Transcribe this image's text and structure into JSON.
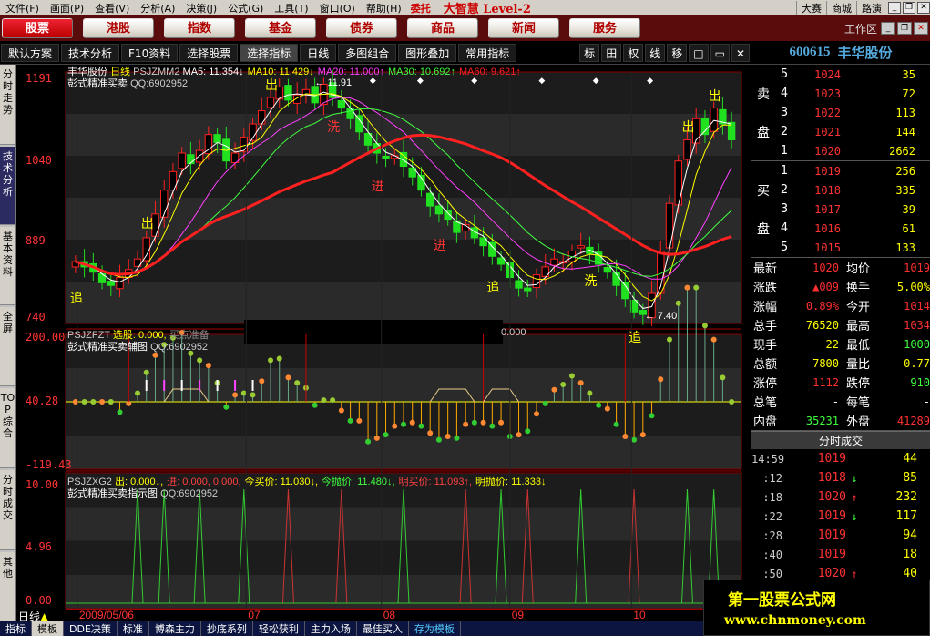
{
  "menu": {
    "items": [
      "文件(F)",
      "画面(P)",
      "查看(V)",
      "分析(A)",
      "决策(J)",
      "公式(G)",
      "工具(T)",
      "窗口(O)",
      "帮助(H)"
    ],
    "weituo": "委托",
    "brand": "大智慧 Level-2",
    "right_items": [
      "大赛",
      "商城",
      "路演"
    ]
  },
  "nav": {
    "buttons": [
      "股票",
      "港股",
      "指数",
      "基金",
      "债券",
      "商品",
      "新闻",
      "服务"
    ],
    "active_index": 0,
    "workspace": "工作区"
  },
  "toolbar": {
    "items": [
      "默认方案",
      "技术分析",
      "F10资料",
      "选择股票",
      "选择指标",
      "日线",
      "多图组合",
      "图形叠加",
      "常用指标"
    ],
    "small": [
      "标",
      "田",
      "权",
      "线",
      "移"
    ]
  },
  "left_tabs": [
    "分时走势",
    "技术分析",
    "基本资料",
    "全屏",
    "TOP综合",
    "分时成交",
    "其他"
  ],
  "left_tab_active": 1,
  "chart": {
    "main_name": "丰华股份",
    "period": "日线",
    "ind1": "PSJZMM2",
    "ma_texts": [
      {
        "t": "MA5: 11.354↓",
        "c": "#ffffff"
      },
      {
        "t": "MA10: 11.429↓",
        "c": "#ffff00"
      },
      {
        "t": "MA20: 11.000↑",
        "c": "#ff40ff"
      },
      {
        "t": "MA30: 10.692↑",
        "c": "#40ff40"
      },
      {
        "t": "MA60: 9.621↑",
        "c": "#ff2020"
      }
    ],
    "sub1_title": "彭式精准买卖",
    "qq": "QQ:6902952",
    "high_label": "11.91",
    "low_label": "7.40",
    "main_y": [
      "1191",
      "1040",
      "889",
      "740"
    ],
    "ind2": "PSJZFZT",
    "ind2_text1": "选股: 0.000,",
    "ind2_text2": "买点准备",
    "ind2_text3": "0.000",
    "sub2_title": "彭式精准买卖辅图",
    "sub2_y": [
      "200.00",
      "40.28",
      "-119.43"
    ],
    "ind3": "PSJZXG2",
    "ind3_texts": [
      {
        "t": "出: 0.000↓,",
        "c": "#ffff00"
      },
      {
        "t": "进: 0.000, 0.000,",
        "c": "#ff4040"
      },
      {
        "t": "今买价: 11.030↓,",
        "c": "#ffff00"
      },
      {
        "t": "今抛价: 11.480↓,",
        "c": "#40ff40"
      },
      {
        "t": "明买价: 11.093↑,",
        "c": "#ff4040"
      },
      {
        "t": "明抛价: 11.333↓",
        "c": "#ffff00"
      }
    ],
    "sub3_title": "彭式精准买卖指示图",
    "sub3_y": [
      "10.00",
      "4.96",
      "0.00"
    ],
    "x_labels": [
      {
        "t": "2009/05/06",
        "x": 0.02
      },
      {
        "t": "07",
        "x": 0.27
      },
      {
        "t": "08",
        "x": 0.47
      },
      {
        "t": "09",
        "x": 0.66
      },
      {
        "t": "10",
        "x": 0.84
      }
    ],
    "signals": {
      "chu": "出",
      "jin": "进",
      "zhui": "追",
      "xi": "洗"
    }
  },
  "chart_data": {
    "type": "candlestick",
    "title": "丰华股份 日线",
    "ylim": [
      7.4,
      11.91
    ],
    "ma_last": {
      "MA5": 11.354,
      "MA10": 11.429,
      "MA20": 11.0,
      "MA30": 10.692,
      "MA60": 9.621
    },
    "close_series": [
      8.5,
      8.4,
      8.3,
      8.1,
      8.05,
      8.2,
      8.35,
      8.55,
      8.95,
      9.4,
      9.85,
      10.2,
      10.55,
      10.35,
      10.6,
      10.9,
      10.75,
      10.4,
      10.55,
      10.85,
      11.1,
      11.35,
      11.6,
      11.8,
      11.55,
      11.65,
      11.75,
      11.5,
      11.85,
      11.6,
      11.4,
      11.2,
      10.95,
      10.7,
      10.55,
      10.45,
      10.5,
      10.3,
      10.1,
      9.85,
      9.55,
      9.4,
      9.3,
      9.05,
      9.2,
      8.95,
      8.8,
      8.6,
      8.45,
      8.2,
      8.0,
      7.95,
      8.25,
      8.4,
      8.55,
      8.5,
      8.7,
      8.8,
      8.65,
      8.45,
      8.3,
      8.05,
      7.8,
      7.55,
      7.5,
      7.9,
      8.7,
      9.6,
      10.4,
      10.8,
      11.2,
      10.9,
      11.4,
      11.1,
      10.8
    ],
    "sub2_ylim": [
      -119.43,
      200.0
    ],
    "sub2_mid": 40.28,
    "sub3_ylim": [
      0.0,
      10.0
    ],
    "sub3_mid": 4.96
  },
  "stock": {
    "code": "600615",
    "name": "丰华股份"
  },
  "book": {
    "sell_label": [
      "卖",
      "盘"
    ],
    "buy_label": [
      "买",
      "盘"
    ],
    "sells": [
      {
        "lv": "5",
        "p": "1024",
        "v": "35"
      },
      {
        "lv": "4",
        "p": "1023",
        "v": "72"
      },
      {
        "lv": "3",
        "p": "1022",
        "v": "113"
      },
      {
        "lv": "2",
        "p": "1021",
        "v": "144"
      },
      {
        "lv": "1",
        "p": "1020",
        "v": "2662"
      }
    ],
    "buys": [
      {
        "lv": "1",
        "p": "1019",
        "v": "256"
      },
      {
        "lv": "2",
        "p": "1018",
        "v": "335"
      },
      {
        "lv": "3",
        "p": "1017",
        "v": "39"
      },
      {
        "lv": "4",
        "p": "1016",
        "v": "61"
      },
      {
        "lv": "5",
        "p": "1015",
        "v": "133"
      }
    ]
  },
  "quote": [
    {
      "k": "最新",
      "v": "1020",
      "vc": "#ff3030",
      "k2": "均价",
      "v2": "1019",
      "v2c": "#ff3030"
    },
    {
      "k": "涨跌",
      "v": "▲009",
      "vc": "#ff3030",
      "k2": "换手",
      "v2": "5.00%",
      "v2c": "#ffff00"
    },
    {
      "k": "涨幅",
      "v": "0.89%",
      "vc": "#ff3030",
      "k2": "今开",
      "v2": "1014",
      "v2c": "#ff3030"
    },
    {
      "k": "总手",
      "v": "76520",
      "vc": "#ffff00",
      "k2": "最高",
      "v2": "1034",
      "v2c": "#ff3030"
    },
    {
      "k": "现手",
      "v": "22",
      "vc": "#ffff00",
      "k2": "最低",
      "v2": "1000",
      "v2c": "#40ff40"
    },
    {
      "k": "总额",
      "v": "7800",
      "vc": "#ffff00",
      "k2": "量比",
      "v2": "0.77",
      "v2c": "#ffff00"
    },
    {
      "k": "涨停",
      "v": "1112",
      "vc": "#ff3030",
      "k2": "跌停",
      "v2": "910",
      "v2c": "#40ff40"
    },
    {
      "k": "总笔",
      "v": "-",
      "vc": "#ffffff",
      "k2": "每笔",
      "v2": "-",
      "v2c": "#ffffff"
    },
    {
      "k": "内盘",
      "v": "35231",
      "vc": "#40ff40",
      "k2": "外盘",
      "v2": "41289",
      "v2c": "#ff3030"
    }
  ],
  "ticks_title": "分时成交",
  "ticks": [
    {
      "t": "14:59",
      "p": "1019",
      "a": "",
      "ac": "#fff",
      "q": "44"
    },
    {
      "t": ":12",
      "p": "1018",
      "a": "↓",
      "ac": "#40ff40",
      "q": "85"
    },
    {
      "t": ":18",
      "p": "1020",
      "a": "↑",
      "ac": "#ff3030",
      "q": "232"
    },
    {
      "t": ":22",
      "p": "1019",
      "a": "↓",
      "ac": "#40ff40",
      "q": "117"
    },
    {
      "t": ":28",
      "p": "1019",
      "a": "",
      "ac": "#fff",
      "q": "94"
    },
    {
      "t": ":40",
      "p": "1019",
      "a": "",
      "ac": "#fff",
      "q": "18"
    },
    {
      "t": ":50",
      "p": "1020",
      "a": "↑",
      "ac": "#ff3030",
      "q": "40"
    }
  ],
  "bottom": {
    "period": "日线",
    "tabs": [
      "指标",
      "模板",
      "DDE决策",
      "标准",
      "博森主力",
      "抄底系列",
      "轻松获利",
      "主力入场",
      "最佳买入",
      "存为模板"
    ],
    "active_index": 1
  },
  "watermark": {
    "l1": "第一股票公式网",
    "l2": "www.chnmoney.com"
  },
  "colors": {
    "up": "#ff2020",
    "down": "#20e020",
    "bg": "#000000",
    "ma5": "#ffffff",
    "ma10": "#ffff00",
    "ma20": "#ff40ff",
    "ma30": "#40ff40",
    "ma60": "#ff2020"
  }
}
